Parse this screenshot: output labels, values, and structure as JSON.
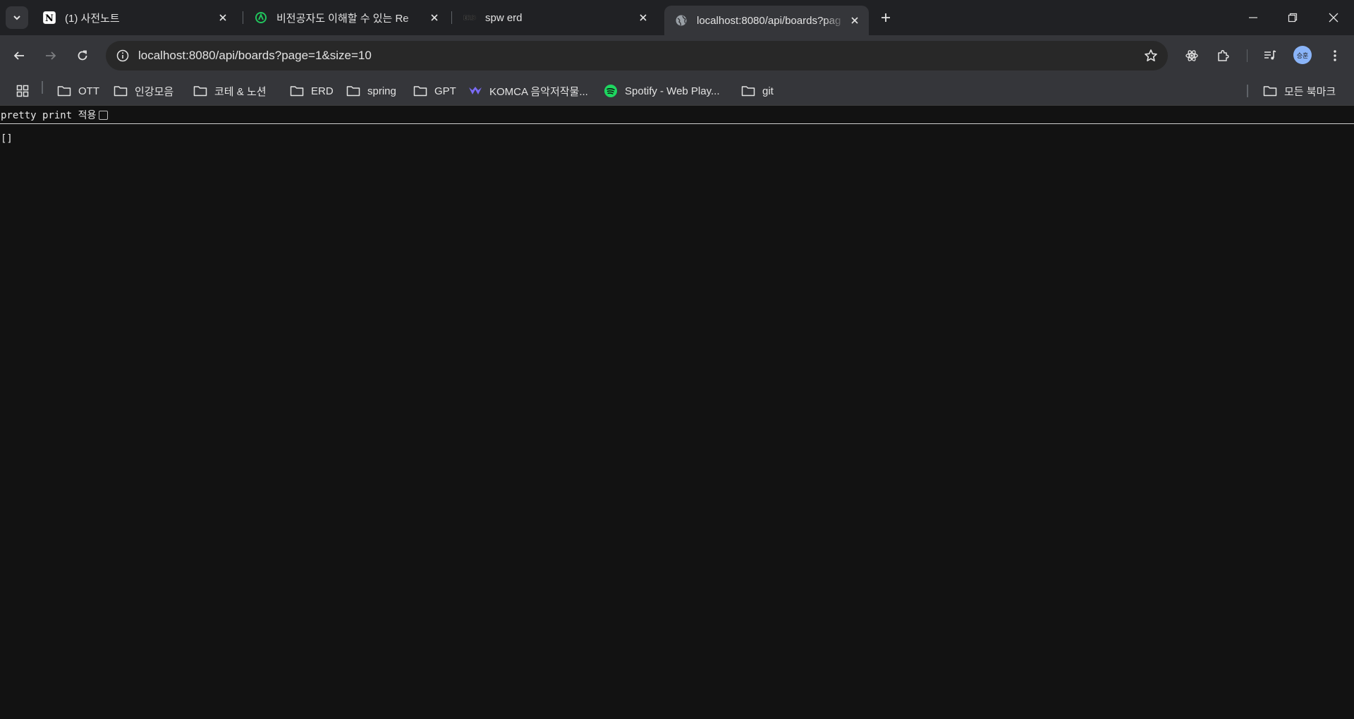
{
  "tabs": [
    {
      "title": "(1) 사전노트",
      "icon": "notion-icon",
      "active": false
    },
    {
      "title": "비전공자도 이해할 수 있는 Re",
      "icon": "green-logo-icon",
      "active": false
    },
    {
      "title": "spw erd",
      "icon": "erd-icon",
      "active": false
    },
    {
      "title": "localhost:8080/api/boards?pag",
      "icon": "globe-icon",
      "active": true
    }
  ],
  "toolbar": {
    "url": "localhost:8080/api/boards?page=1&size=10",
    "avatar_text": "승훈"
  },
  "bookmarks": {
    "items": [
      {
        "label": "OTT",
        "icon": "folder-icon"
      },
      {
        "label": "인강모음",
        "icon": "folder-icon"
      },
      {
        "label": "코테 & 노션",
        "icon": "folder-icon"
      },
      {
        "label": "ERD",
        "icon": "folder-icon"
      },
      {
        "label": "spring",
        "icon": "folder-icon"
      },
      {
        "label": "GPT",
        "icon": "folder-icon"
      },
      {
        "label": "KOMCA 음악저작물...",
        "icon": "komca-icon"
      },
      {
        "label": "Spotify - Web Play...",
        "icon": "spotify-icon"
      },
      {
        "label": "git",
        "icon": "folder-icon"
      }
    ],
    "all_bookmarks": "모든 북마크"
  },
  "page": {
    "pretty_print_label": "pretty print 적용",
    "pretty_print_checked": false,
    "body": "[]"
  },
  "colors": {
    "tab_bg": "#202124",
    "toolbar_bg": "#35363a",
    "page_bg": "#121212",
    "spotify_green": "#1ed760",
    "komca_purple": "#7b6cf6"
  }
}
